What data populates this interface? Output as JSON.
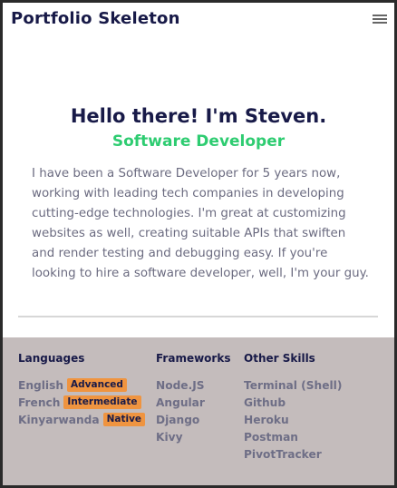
{
  "header": {
    "brand": "Portfolio Skeleton",
    "menu_icon": "hamburger-menu-icon"
  },
  "hero": {
    "title": "Hello there! I'm Steven.",
    "subtitle": "Software Developer",
    "bio": "I have been a Software Developer for 5 years now, working with leading tech companies in developing cutting-edge technologies. I'm great at customizing websites as well, creating suitable APIs that swiften and render testing and debugging easy. If you're looking to hire a software developer, well, I'm your guy."
  },
  "skills": {
    "languages": {
      "heading": "Languages",
      "items": [
        {
          "name": "English",
          "level": "Advanced"
        },
        {
          "name": "French",
          "level": "Intermediate"
        },
        {
          "name": "Kinyarwanda",
          "level": "Native"
        }
      ]
    },
    "frameworks": {
      "heading": "Frameworks",
      "items": [
        "Node.JS",
        "Angular",
        "Django",
        "Kivy"
      ]
    },
    "other": {
      "heading": "Other Skills",
      "items": [
        "Terminal (Shell)",
        "Github",
        "Heroku",
        "Postman",
        "PivotTracker"
      ]
    }
  },
  "colors": {
    "navy": "#181a48",
    "accent_green": "#2ecc71",
    "badge_orange": "#ef9440",
    "footer_bg": "#c4bcbc",
    "body_text": "#6b6b80"
  }
}
